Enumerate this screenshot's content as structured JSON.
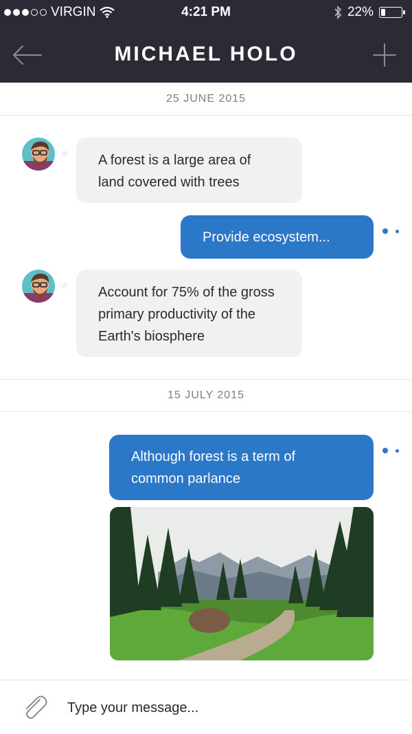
{
  "status_bar": {
    "carrier": "VIRGIN",
    "time": "4:21 PM",
    "battery": "22%",
    "battery_level": 0.22
  },
  "header": {
    "title": "MICHAEL HOLO",
    "back_icon": "arrow-left-icon",
    "add_icon": "plus-icon"
  },
  "conversation": {
    "dates": [
      "25 JUNE 2015",
      "15 JULY 2015"
    ],
    "messages": [
      {
        "direction": "incoming",
        "text": "A forest is a large area of land covered with trees"
      },
      {
        "direction": "outgoing",
        "text": "Provide ecosystem..."
      },
      {
        "direction": "incoming",
        "text": "Account for 75% of the gross primary productivity of the Earth's biosphere"
      },
      {
        "direction": "outgoing",
        "text": "Although forest is a term of common parlance"
      }
    ]
  },
  "composer": {
    "placeholder": "Type your message...",
    "attach_icon": "paperclip-icon"
  },
  "colors": {
    "header_bg": "#2b2b35",
    "outgoing_bubble": "#2a78c7",
    "incoming_bubble": "#f1f1f3"
  }
}
